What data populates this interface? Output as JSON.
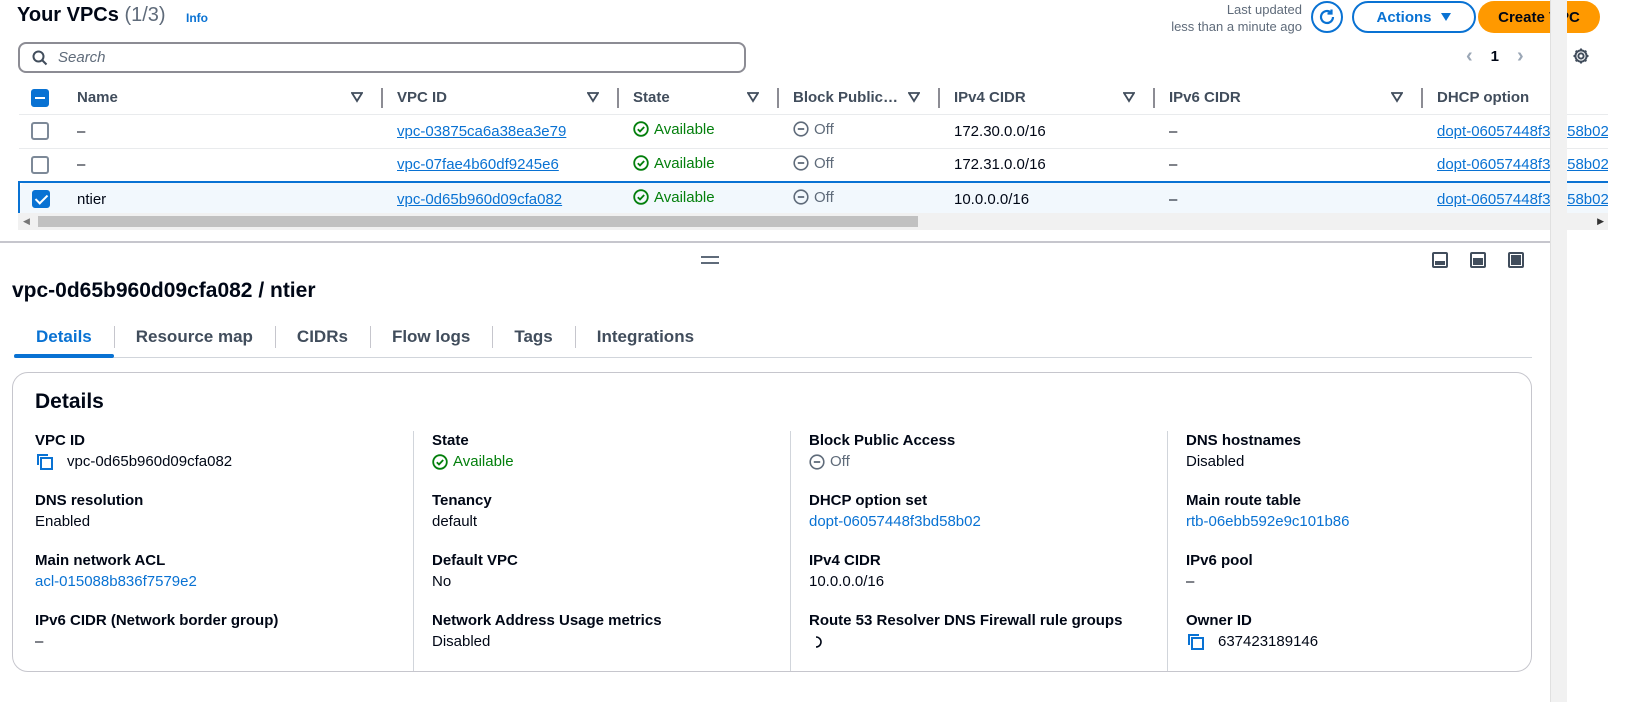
{
  "header": {
    "title": "Your VPCs",
    "count": "(1/3)",
    "info": "Info",
    "last_updated_line1": "Last updated",
    "last_updated_line2": "less than a minute ago",
    "actions_label": "Actions",
    "create_label": "Create VPC"
  },
  "search": {
    "placeholder": "Search",
    "value": ""
  },
  "pagination": {
    "current_page": "1"
  },
  "table": {
    "columns": [
      "Name",
      "VPC ID",
      "State",
      "Block Public…",
      "IPv4 CIDR",
      "IPv6 CIDR",
      "DHCP option"
    ],
    "rows": [
      {
        "selected": false,
        "name": "–",
        "vpc_id": "vpc-03875ca6a38ea3e79",
        "state": "Available",
        "block": "Off",
        "ipv4": "172.30.0.0/16",
        "ipv6": "–",
        "dhcp": "dopt-06057448f3bd58b02"
      },
      {
        "selected": false,
        "name": "–",
        "vpc_id": "vpc-07fae4b60df9245e6",
        "state": "Available",
        "block": "Off",
        "ipv4": "172.31.0.0/16",
        "ipv6": "–",
        "dhcp": "dopt-06057448f3bd58b02"
      },
      {
        "selected": true,
        "name": "ntier",
        "vpc_id": "vpc-0d65b960d09cfa082",
        "state": "Available",
        "block": "Off",
        "ipv4": "10.0.0.0/16",
        "ipv6": "–",
        "dhcp": "dopt-06057448f3bd58b02"
      }
    ]
  },
  "detail": {
    "heading": "vpc-0d65b960d09cfa082 / ntier",
    "tabs": [
      "Details",
      "Resource map",
      "CIDRs",
      "Flow logs",
      "Tags",
      "Integrations"
    ],
    "active_tab": "Details",
    "card_title": "Details",
    "fields": {
      "vpc_id": {
        "label": "VPC ID",
        "value": "vpc-0d65b960d09cfa082"
      },
      "state": {
        "label": "State",
        "value": "Available"
      },
      "block_public_access": {
        "label": "Block Public Access",
        "value": "Off"
      },
      "dns_hostnames": {
        "label": "DNS hostnames",
        "value": "Disabled"
      },
      "dns_resolution": {
        "label": "DNS resolution",
        "value": "Enabled"
      },
      "tenancy": {
        "label": "Tenancy",
        "value": "default"
      },
      "dhcp_option_set": {
        "label": "DHCP option set",
        "value": "dopt-06057448f3bd58b02"
      },
      "main_route_table": {
        "label": "Main route table",
        "value": "rtb-06ebb592e9c101b86"
      },
      "main_network_acl": {
        "label": "Main network ACL",
        "value": "acl-015088b836f7579e2"
      },
      "default_vpc": {
        "label": "Default VPC",
        "value": "No"
      },
      "ipv4_cidr": {
        "label": "IPv4 CIDR",
        "value": "10.0.0.0/16"
      },
      "ipv6_pool": {
        "label": "IPv6 pool",
        "value": "–"
      },
      "ipv6_cidr_nbg": {
        "label": "IPv6 CIDR (Network border group)",
        "value": "–"
      },
      "nau_metrics": {
        "label": "Network Address Usage metrics",
        "value": "Disabled"
      },
      "route53_fw": {
        "label": "Route 53 Resolver DNS Firewall rule groups",
        "value": ""
      },
      "owner_id": {
        "label": "Owner ID",
        "value": "637423189146"
      }
    }
  },
  "colors": {
    "accent": "#0972d3",
    "primary_button": "#ff9900",
    "success": "#037f0c",
    "muted": "#5f6b7a"
  }
}
